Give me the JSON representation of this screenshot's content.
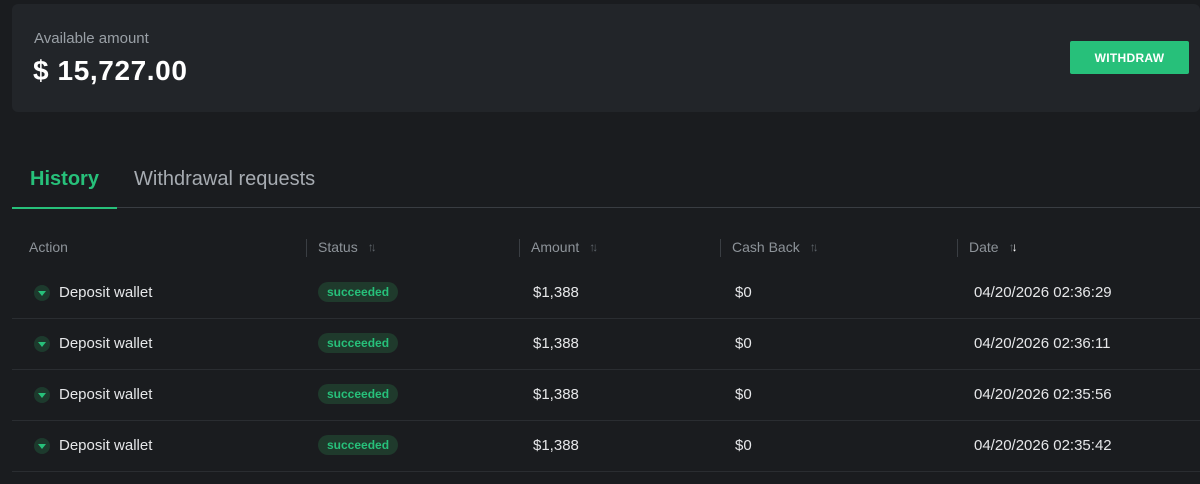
{
  "balance": {
    "label": "Available amount",
    "value": "$ 15,727.00",
    "withdraw_label": "WITHDRAW"
  },
  "tabs": [
    {
      "label": "History",
      "active": true
    },
    {
      "label": "Withdrawal requests",
      "active": false
    }
  ],
  "table": {
    "columns": [
      "Action",
      "Status",
      "Amount",
      "Cash Back",
      "Date"
    ],
    "sort_icon": "sort-updown-icon",
    "rows": [
      {
        "action": "Deposit wallet",
        "status": "succeeded",
        "amount": "$1,388",
        "cashback": "$0",
        "date": "04/20/2026 02:36:29"
      },
      {
        "action": "Deposit wallet",
        "status": "succeeded",
        "amount": "$1,388",
        "cashback": "$0",
        "date": "04/20/2026 02:36:11"
      },
      {
        "action": "Deposit wallet",
        "status": "succeeded",
        "amount": "$1,388",
        "cashback": "$0",
        "date": "04/20/2026 02:35:56"
      },
      {
        "action": "Deposit wallet",
        "status": "succeeded",
        "amount": "$1,388",
        "cashback": "$0",
        "date": "04/20/2026 02:35:42"
      }
    ]
  },
  "colors": {
    "accent": "#27c07a",
    "background": "#1a1c1f",
    "card": "#222529"
  }
}
